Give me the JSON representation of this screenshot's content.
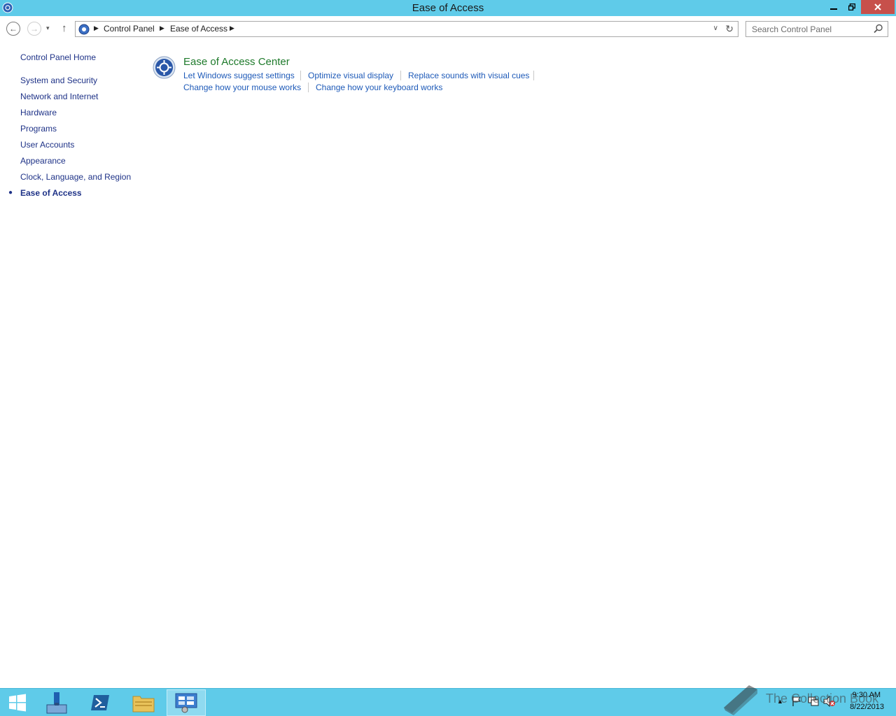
{
  "window": {
    "title": "Ease of Access",
    "controls": {
      "minimize": "‒",
      "maximize": "❐",
      "close": "✕"
    }
  },
  "navigation": {
    "back": "←",
    "forward": "→",
    "recent": "▾",
    "up": "↑",
    "breadcrumb": [
      "Control Panel",
      "Ease of Access"
    ],
    "dropdown": "∨",
    "refresh": "↻"
  },
  "search": {
    "placeholder": "Search Control Panel"
  },
  "sidebar": {
    "home": "Control Panel Home",
    "items": [
      "System and Security",
      "Network and Internet",
      "Hardware",
      "Programs",
      "User Accounts",
      "Appearance",
      "Clock, Language, and Region",
      "Ease of Access"
    ],
    "current_bullet": "●"
  },
  "category": {
    "title": "Ease of Access Center",
    "links_row1": [
      "Let Windows suggest settings",
      "Optimize visual display",
      "Replace sounds with visual cues"
    ],
    "links_row2": [
      "Change how your mouse works",
      "Change how your keyboard works"
    ]
  },
  "taskbar": {
    "clock_time": "9:30 AM",
    "clock_date": "8/22/2013",
    "tray_show_hidden": "▲"
  },
  "watermark": {
    "text": "The Collection Book"
  },
  "colors": {
    "titlebar": "#5fcbe9",
    "close": "#c7504b",
    "link": "#1e5ab8",
    "category_title": "#1e7a2b",
    "nav_text": "#1e3287"
  }
}
